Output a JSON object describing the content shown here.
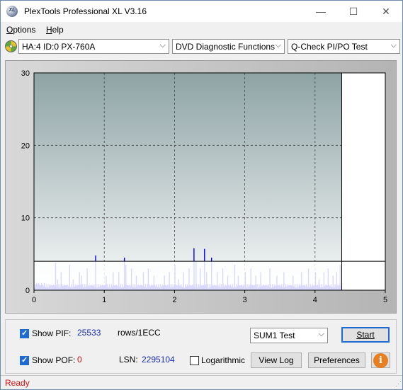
{
  "window": {
    "title": "PlexTools Professional XL V3.16",
    "app_icon_text": "XL",
    "controls": {
      "minimize": "—",
      "maximize": "☐",
      "close": "✕"
    }
  },
  "menu": {
    "items": [
      {
        "label": "Options",
        "mnemonic": "O",
        "rest": "ptions"
      },
      {
        "label": "Help",
        "mnemonic": "H",
        "rest": "elp"
      }
    ]
  },
  "toolbar": {
    "drive_select": "HA:4 ID:0  PX-760A",
    "function_select": "DVD Diagnostic Functions",
    "test_select": "Q-Check PI/PO Test"
  },
  "chart_data": {
    "type": "bar",
    "xlim": [
      0,
      5
    ],
    "ylim": [
      0,
      30
    ],
    "x_ticks": [
      "0",
      "1",
      "2",
      "3",
      "4",
      "5"
    ],
    "y_ticks": [
      "30",
      "20",
      "10",
      "0"
    ],
    "grid": true,
    "sum_threshold": 4,
    "end_marker_x": 4.38,
    "series_color": "#0000ff",
    "spikes": [
      {
        "x": 0.03,
        "y": 1
      },
      {
        "x": 0.06,
        "y": 1
      },
      {
        "x": 0.1,
        "y": 1
      },
      {
        "x": 0.14,
        "y": 1
      },
      {
        "x": 0.3,
        "y": 3.8
      },
      {
        "x": 0.33,
        "y": 1.5
      },
      {
        "x": 0.38,
        "y": 2.5
      },
      {
        "x": 0.5,
        "y": 3.5
      },
      {
        "x": 0.55,
        "y": 1.5
      },
      {
        "x": 0.64,
        "y": 2.5
      },
      {
        "x": 0.67,
        "y": 2
      },
      {
        "x": 0.75,
        "y": 3
      },
      {
        "x": 0.87,
        "y": 4.8
      },
      {
        "x": 1.02,
        "y": 2
      },
      {
        "x": 1.12,
        "y": 2.5
      },
      {
        "x": 1.2,
        "y": 2.5
      },
      {
        "x": 1.28,
        "y": 4.5
      },
      {
        "x": 1.3,
        "y": 3.5
      },
      {
        "x": 1.38,
        "y": 3
      },
      {
        "x": 1.45,
        "y": 2
      },
      {
        "x": 1.55,
        "y": 2.5
      },
      {
        "x": 1.62,
        "y": 3
      },
      {
        "x": 1.7,
        "y": 2
      },
      {
        "x": 1.85,
        "y": 2
      },
      {
        "x": 1.92,
        "y": 2.5
      },
      {
        "x": 2.0,
        "y": 3.5
      },
      {
        "x": 2.05,
        "y": 1.5
      },
      {
        "x": 2.12,
        "y": 2.5
      },
      {
        "x": 2.2,
        "y": 3
      },
      {
        "x": 2.27,
        "y": 5.8
      },
      {
        "x": 2.3,
        "y": 4
      },
      {
        "x": 2.36,
        "y": 3
      },
      {
        "x": 2.42,
        "y": 5.7
      },
      {
        "x": 2.45,
        "y": 2.5
      },
      {
        "x": 2.52,
        "y": 4.5
      },
      {
        "x": 2.6,
        "y": 2.5
      },
      {
        "x": 2.68,
        "y": 3
      },
      {
        "x": 2.75,
        "y": 2
      },
      {
        "x": 2.85,
        "y": 3.5
      },
      {
        "x": 2.9,
        "y": 2
      },
      {
        "x": 3.0,
        "y": 2.5
      },
      {
        "x": 3.08,
        "y": 3
      },
      {
        "x": 3.15,
        "y": 2
      },
      {
        "x": 3.22,
        "y": 2.5
      },
      {
        "x": 3.35,
        "y": 3
      },
      {
        "x": 3.45,
        "y": 2
      },
      {
        "x": 3.55,
        "y": 2.5
      },
      {
        "x": 3.68,
        "y": 2
      },
      {
        "x": 3.8,
        "y": 2.5
      },
      {
        "x": 3.9,
        "y": 3
      },
      {
        "x": 4.0,
        "y": 2.5
      },
      {
        "x": 4.05,
        "y": 1.5
      },
      {
        "x": 4.12,
        "y": 2.5
      },
      {
        "x": 4.18,
        "y": 3
      },
      {
        "x": 4.25,
        "y": 2
      },
      {
        "x": 4.3,
        "y": 2.5
      },
      {
        "x": 4.35,
        "y": 3.5
      }
    ],
    "baseline_level": 0.6
  },
  "controls": {
    "show_pif_label": "Show PIF:",
    "pif_value": "25533",
    "pif_unit": "rows/1ECC",
    "show_pof_label": "Show POF:",
    "pof_value": "0",
    "lsn_label": "LSN:",
    "lsn_value": "2295104",
    "logarithmic_label": "Logarithmic",
    "sum_select": "SUM1 Test",
    "start_button": "Start",
    "view_log_button": "View Log",
    "preferences_button": "Preferences",
    "info_button": "i"
  },
  "status": {
    "text": "Ready"
  }
}
